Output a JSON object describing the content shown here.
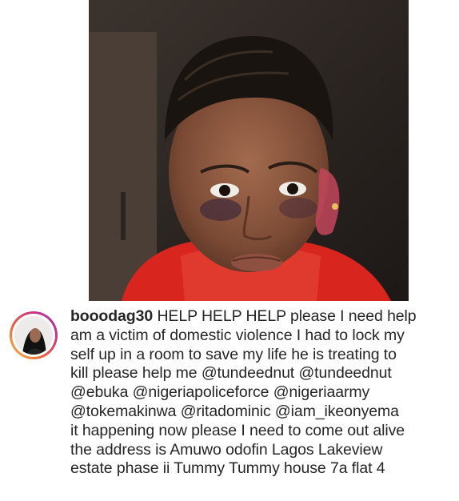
{
  "post": {
    "username": "booodag30",
    "caption_lines": [
      "HELP HELP HELP please I need help",
      "am a victim of domestic violence I had to lock my",
      "self up in a room to save my life he is treating to",
      "kill please help me @tundeednut @tundeednut",
      "@ebuka @nigeriapoliceforce @nigeriaarmy",
      "@tokemakinwa @ritadominic @iam_ikeonyema",
      "it happening now please I need to come out alive",
      "the address is Amuwo odofin Lagos Lakeview",
      "estate phase ii Tummy Tummy house 7a flat 4"
    ]
  },
  "colors": {
    "text": "#262626",
    "story_ring_start": "#f6c04a",
    "story_ring_end": "#8a3ab9",
    "shirt": "#d8261f"
  },
  "icons": {
    "avatar": "profile-avatar",
    "photo": "post-photo"
  }
}
